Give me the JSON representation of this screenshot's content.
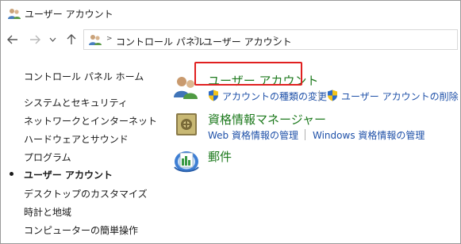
{
  "window": {
    "title": "ユーザー アカウント"
  },
  "nav": {
    "breadcrumb": [
      "コントロール パネル",
      "ユーザー アカウント"
    ]
  },
  "sidebar": {
    "home": "コントロール パネル ホーム",
    "items": [
      {
        "label": "システムとセキュリティ",
        "current": false
      },
      {
        "label": "ネットワークとインターネット",
        "current": false
      },
      {
        "label": "ハードウェアとサウンド",
        "current": false
      },
      {
        "label": "プログラム",
        "current": false
      },
      {
        "label": "ユーザー アカウント",
        "current": true
      },
      {
        "label": "デスクトップのカスタマイズ",
        "current": false
      },
      {
        "label": "時計と地域",
        "current": false
      },
      {
        "label": "コンピューターの簡単操作",
        "current": false
      }
    ]
  },
  "main": {
    "categories": [
      {
        "title": "ユーザー アカウント",
        "icon": "users-icon",
        "links": [
          "アカウントの種類の変更",
          "ユーザー アカウントの削除"
        ]
      },
      {
        "title": "資格情報マネージャー",
        "icon": "vault-icon",
        "links": [
          "Web 資格情報の管理",
          "Windows 資格情報の管理"
        ]
      },
      {
        "title": "郵件",
        "icon": "mail-icon",
        "links": []
      }
    ]
  },
  "colors": {
    "category_title": "#1e7a1e",
    "link": "#1e50a8",
    "highlight_border": "#e02020"
  }
}
